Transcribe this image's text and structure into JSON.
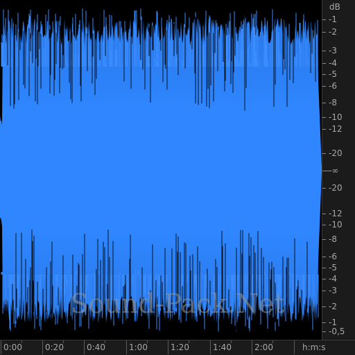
{
  "editor": {
    "db_unit": "dB",
    "db_scale_top": [
      "-1",
      "-2",
      "-3",
      "-4",
      "-5",
      "-6",
      "-8",
      "-10",
      "-12",
      "-20"
    ],
    "db_center": "-∞",
    "db_scale_bottom": [
      "-20",
      "-12",
      "-10",
      "-8",
      "-6",
      "-5",
      "-4",
      "-3",
      "-2",
      "-1",
      "-0,5"
    ],
    "time_labels": [
      "0:00",
      "0:20",
      "0:40",
      "1:00",
      "1:20",
      "1:40",
      "2:00"
    ],
    "time_unit": "h:m:s",
    "watermark": "Sound-Pack.Net",
    "colors": {
      "waveform": "#2f86ff",
      "waveform_dark": "#1f5fc0",
      "background": "#000000",
      "ruler_bg": "#1b1b1b",
      "ruler_text": "#a8a8a8"
    }
  }
}
